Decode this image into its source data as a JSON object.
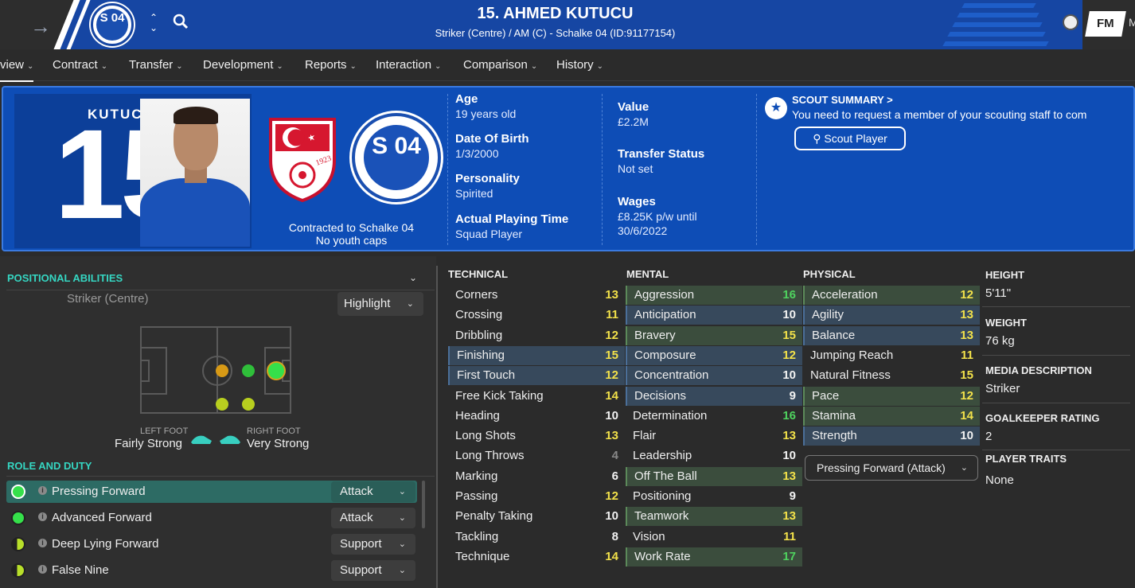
{
  "header": {
    "player_title": "15. AHMED KUTUCU",
    "player_subtitle": "Striker (Centre) / AM (C) - Schalke 04 (ID:91177154)",
    "club_badge_text": "S 04",
    "fm_logo": "FM",
    "right_cut": "M",
    "colors": {
      "bar": "#1646a3",
      "accent": "#35d6c2"
    }
  },
  "menu": [
    {
      "label": "view",
      "active": true
    },
    {
      "label": "Contract"
    },
    {
      "label": "Transfer"
    },
    {
      "label": "Development"
    },
    {
      "label": "Reports"
    },
    {
      "label": "Interaction"
    },
    {
      "label": "Comparison"
    },
    {
      "label": "History"
    }
  ],
  "banner": {
    "shirt_name": "KUTUC",
    "shirt_number": "15",
    "contracted": "Contracted to Schalke 04",
    "caps": "No youth caps",
    "age_label": "Age",
    "age_value": "19 years old",
    "dob_label": "Date Of Birth",
    "dob_value": "1/3/2000",
    "personality_label": "Personality",
    "personality_value": "Spirited",
    "apt_label": "Actual Playing Time",
    "apt_value": "Squad Player",
    "value_label": "Value",
    "value_value": "£2.2M",
    "transfer_label": "Transfer Status",
    "transfer_value": "Not set",
    "wages_label": "Wages",
    "wages_value_1": "£8.25K p/w until",
    "wages_value_2": "30/6/2022",
    "scout_title": "SCOUT SUMMARY >",
    "scout_desc": "You need to request a member of your scouting staff to com",
    "scout_button": "Scout Player",
    "flag_year": "1923"
  },
  "positional": {
    "title": "POSITIONAL ABILITIES",
    "position": "Striker (Centre)",
    "highlight": "Highlight",
    "left_foot_label": "LEFT FOOT",
    "left_foot_value": "Fairly Strong",
    "right_foot_label": "RIGHT FOOT",
    "right_foot_value": "Very Strong"
  },
  "roles": {
    "title": "ROLE AND DUTY",
    "items": [
      {
        "name": "Pressing Forward",
        "duty": "Attack"
      },
      {
        "name": "Advanced Forward",
        "duty": "Attack"
      },
      {
        "name": "Deep Lying Forward",
        "duty": "Support"
      },
      {
        "name": "False Nine",
        "duty": "Support"
      }
    ]
  },
  "technical": {
    "title": "TECHNICAL",
    "attrs": [
      {
        "name": "Corners",
        "value": "13"
      },
      {
        "name": "Crossing",
        "value": "11"
      },
      {
        "name": "Dribbling",
        "value": "12"
      },
      {
        "name": "Finishing",
        "value": "15"
      },
      {
        "name": "First Touch",
        "value": "12"
      },
      {
        "name": "Free Kick Taking",
        "value": "14"
      },
      {
        "name": "Heading",
        "value": "10"
      },
      {
        "name": "Long Shots",
        "value": "13"
      },
      {
        "name": "Long Throws",
        "value": "4"
      },
      {
        "name": "Marking",
        "value": "6"
      },
      {
        "name": "Passing",
        "value": "12"
      },
      {
        "name": "Penalty Taking",
        "value": "10"
      },
      {
        "name": "Tackling",
        "value": "8"
      },
      {
        "name": "Technique",
        "value": "14"
      }
    ]
  },
  "mental": {
    "title": "MENTAL",
    "attrs": [
      {
        "name": "Aggression",
        "value": "16"
      },
      {
        "name": "Anticipation",
        "value": "10"
      },
      {
        "name": "Bravery",
        "value": "15"
      },
      {
        "name": "Composure",
        "value": "12"
      },
      {
        "name": "Concentration",
        "value": "10"
      },
      {
        "name": "Decisions",
        "value": "9"
      },
      {
        "name": "Determination",
        "value": "16"
      },
      {
        "name": "Flair",
        "value": "13"
      },
      {
        "name": "Leadership",
        "value": "10"
      },
      {
        "name": "Off The Ball",
        "value": "13"
      },
      {
        "name": "Positioning",
        "value": "9"
      },
      {
        "name": "Teamwork",
        "value": "13"
      },
      {
        "name": "Vision",
        "value": "11"
      },
      {
        "name": "Work Rate",
        "value": "17"
      }
    ]
  },
  "physical": {
    "title": "PHYSICAL",
    "attrs": [
      {
        "name": "Acceleration",
        "value": "12"
      },
      {
        "name": "Agility",
        "value": "13"
      },
      {
        "name": "Balance",
        "value": "13"
      },
      {
        "name": "Jumping Reach",
        "value": "11"
      },
      {
        "name": "Natural Fitness",
        "value": "15"
      },
      {
        "name": "Pace",
        "value": "12"
      },
      {
        "name": "Stamina",
        "value": "14"
      },
      {
        "name": "Strength",
        "value": "10"
      }
    ],
    "role_select": "Pressing Forward (Attack)"
  },
  "info": {
    "height_label": "HEIGHT",
    "height_value": "5'11\"",
    "weight_label": "WEIGHT",
    "weight_value": "76 kg",
    "media_label": "MEDIA DESCRIPTION",
    "media_value": "Striker",
    "gk_label": "GOALKEEPER RATING",
    "gk_value": "2",
    "traits_label": "PLAYER TRAITS",
    "traits_value": "None"
  }
}
